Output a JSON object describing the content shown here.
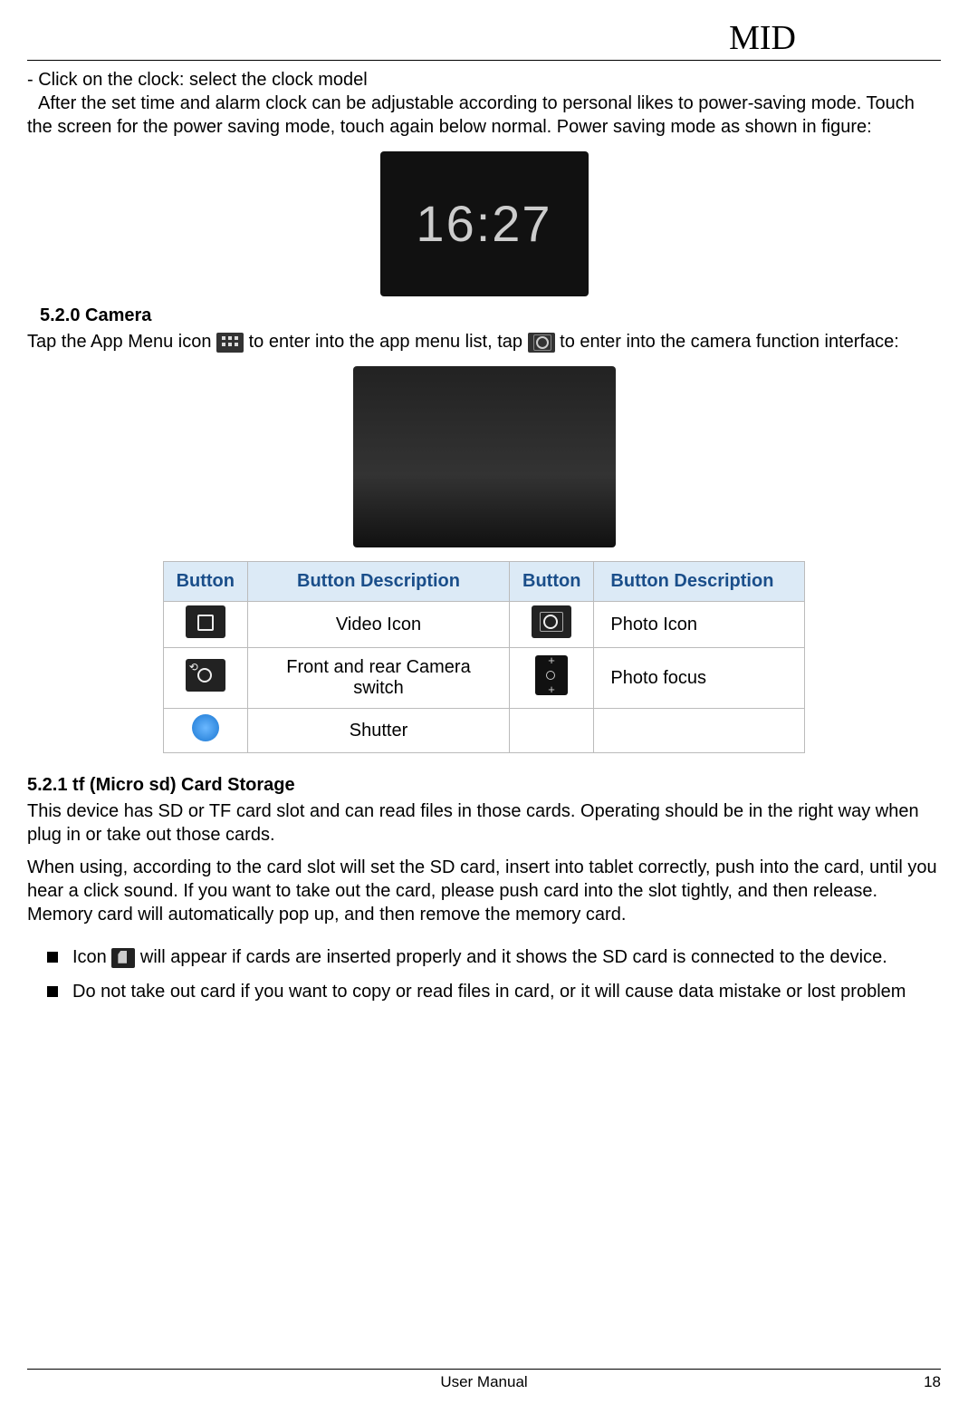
{
  "header": {
    "title": "MID"
  },
  "intro": {
    "line1": "- Click on the clock: select the clock model",
    "para": "After the set time and alarm clock can be adjustable according to personal likes to power-saving mode. Touch the screen for the power saving mode, touch again below normal. Power saving mode as shown in figure:"
  },
  "clock_figure": {
    "time": "16:27"
  },
  "section_camera": {
    "title": "5.2.0 Camera",
    "text_a": "Tap the App Menu icon ",
    "text_b": " to enter into the app menu list, tap ",
    "text_c": "  to enter into the camera function interface:"
  },
  "camera_table": {
    "headers": [
      "Button",
      "Button Description",
      "Button",
      "Button Description"
    ],
    "rows": [
      {
        "icon1": "video",
        "desc1": "Video Icon",
        "icon2": "photo",
        "desc2": "Photo Icon"
      },
      {
        "icon1": "switch",
        "desc1": "Front and rear Camera switch",
        "icon2": "focus",
        "desc2": "Photo focus"
      },
      {
        "icon1": "shutter",
        "desc1": "Shutter",
        "icon2": "",
        "desc2": ""
      }
    ]
  },
  "section_sd": {
    "title": "5.2.1 tf (Micro sd) Card Storage",
    "para1": "This device has SD or TF card slot and can read files in those cards. Operating should be in the right way when plug in or take out those cards.",
    "para2": "When using, according to the card slot will set the SD card, insert into tablet correctly, push into the card, until you hear a click sound. If you want to take out the card, please push card into the slot tightly, and then release. Memory card will automatically pop up, and then remove the memory card.",
    "bullets": {
      "b1a": "Icon ",
      "b1b": " will appear if cards are inserted properly and it shows the SD card is connected to the device.",
      "b2": "Do not take out card if you want to copy or read files in card, or it will cause data mistake or lost problem"
    }
  },
  "footer": {
    "center": "User Manual",
    "page": "18"
  }
}
